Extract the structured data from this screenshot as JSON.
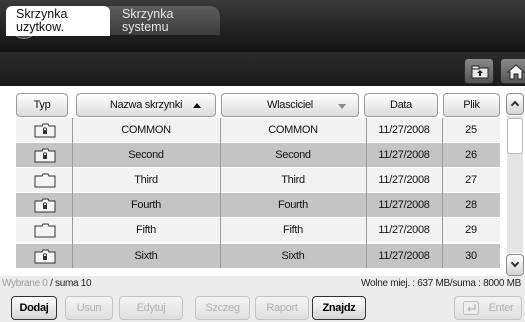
{
  "help": {
    "label": "?"
  },
  "tabs": {
    "active": {
      "line1": "Skrzynka",
      "line2": "uzytkow."
    },
    "inactive": {
      "line1": "Skrzynka",
      "line2": "systemu"
    }
  },
  "header_icons": [
    "upload-folder-icon",
    "home-icon"
  ],
  "table": {
    "columns": {
      "type": "Typ",
      "name": "Nazwa skrzynki",
      "owner": "Wlasciciel",
      "date": "Data",
      "file": "Plik"
    },
    "rows": [
      {
        "icon": "locked-folder-icon",
        "name": "COMMON",
        "owner": "COMMON",
        "date": "11/27/2008",
        "file": "25"
      },
      {
        "icon": "locked-folder-icon",
        "name": "Second",
        "owner": "Second",
        "date": "11/27/2008",
        "file": "26"
      },
      {
        "icon": "folder-icon",
        "name": "Third",
        "owner": "Third",
        "date": "11/27/2008",
        "file": "27"
      },
      {
        "icon": "locked-folder-icon",
        "name": "Fourth",
        "owner": "Fourth",
        "date": "11/27/2008",
        "file": "28"
      },
      {
        "icon": "folder-icon",
        "name": "Fifth",
        "owner": "Fifth",
        "date": "11/27/2008",
        "file": "29"
      },
      {
        "icon": "locked-folder-icon",
        "name": "Sixth",
        "owner": "Sixth",
        "date": "11/27/2008",
        "file": "30"
      }
    ]
  },
  "status": {
    "selected": "Wybrane 0",
    "total": "/ suma 10",
    "free": "Wolne miej. : 637 MB/suma : 8000 MB"
  },
  "buttons": {
    "add": "Dodaj",
    "delete": "Usun",
    "edit": "Edytuj",
    "details": "Szczeg",
    "report": "Raport",
    "find": "Znajdz",
    "enter": "Enter"
  }
}
